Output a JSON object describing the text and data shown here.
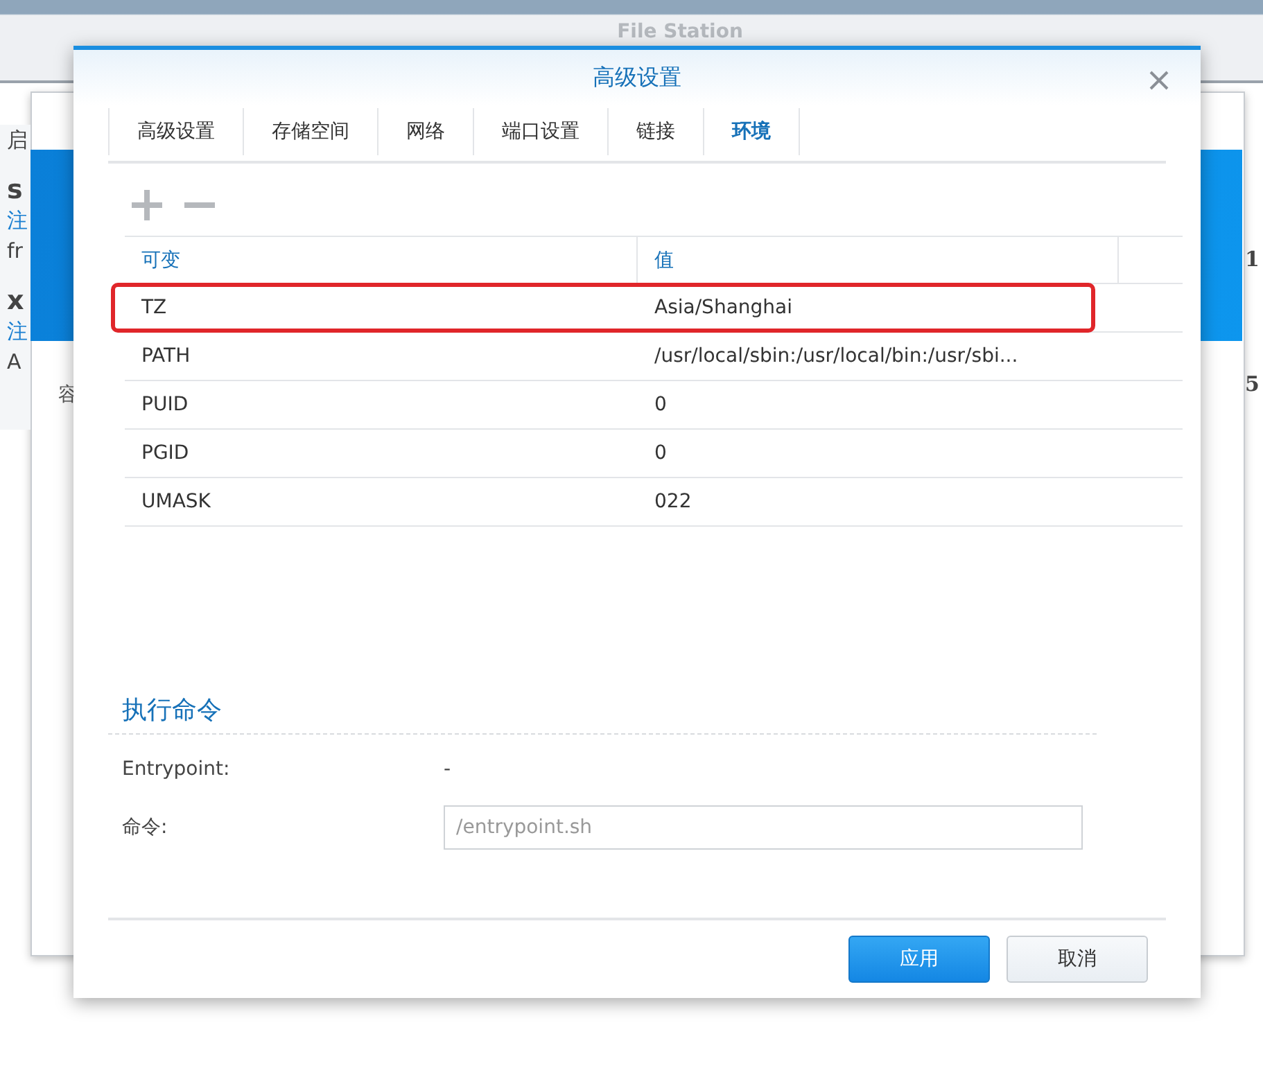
{
  "background": {
    "app_title": "File Station",
    "left_fragments": [
      {
        "text": "启",
        "kind": "plain"
      },
      {
        "text": "s",
        "kind": "bold"
      },
      {
        "text": "注",
        "kind": "link"
      },
      {
        "text": "fr",
        "kind": "plain"
      },
      {
        "text": "x",
        "kind": "bold"
      },
      {
        "text": "注",
        "kind": "link"
      },
      {
        "text": "A",
        "kind": "plain"
      }
    ],
    "mid_fragment": "容",
    "right_fragments": [
      "1",
      "5"
    ]
  },
  "dialog": {
    "title": "高级设置",
    "tabs": [
      {
        "label": "高级设置",
        "selected": false
      },
      {
        "label": "存储空间",
        "selected": false
      },
      {
        "label": "网络",
        "selected": false
      },
      {
        "label": "端口设置",
        "selected": false
      },
      {
        "label": "链接",
        "selected": false
      },
      {
        "label": "环境",
        "selected": true
      }
    ],
    "table": {
      "columns": [
        "可变",
        "值"
      ],
      "rows": [
        {
          "cells": [
            "TZ",
            "Asia/Shanghai"
          ],
          "highlighted": true
        },
        {
          "cells": [
            "PATH",
            "/usr/local/sbin:/usr/local/bin:/usr/sbi..."
          ],
          "highlighted": false
        },
        {
          "cells": [
            "PUID",
            "0"
          ],
          "highlighted": false
        },
        {
          "cells": [
            "PGID",
            "0"
          ],
          "highlighted": false
        },
        {
          "cells": [
            "UMASK",
            "022"
          ],
          "highlighted": false
        }
      ]
    },
    "section_title": "执行命令",
    "fields": [
      {
        "label": "Entrypoint:",
        "value": "-",
        "kind": "text"
      },
      {
        "label": "命令:",
        "placeholder": "/entrypoint.sh",
        "kind": "input"
      }
    ],
    "buttons": [
      {
        "label": "应用",
        "kind": "primary"
      },
      {
        "label": "取消",
        "kind": "secondary"
      }
    ]
  }
}
